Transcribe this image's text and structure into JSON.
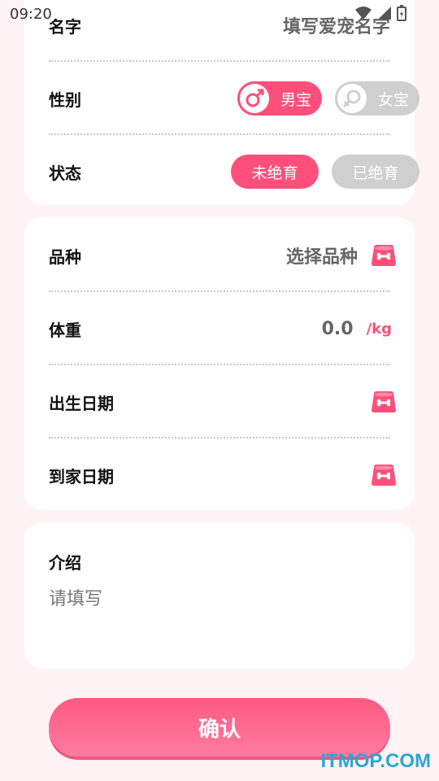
{
  "status_bar": {
    "time": "09:20"
  },
  "basic": {
    "name_label": "名字",
    "name_placeholder": "填写爱宠名字",
    "gender_label": "性别",
    "gender_options": [
      "男宝",
      "女宝"
    ],
    "gender_selected": "男宝",
    "status_label": "状态",
    "status_options": [
      "未绝育",
      "已绝育"
    ],
    "status_selected": "未绝育"
  },
  "details": {
    "breed_label": "品种",
    "breed_value": "选择品种",
    "weight_label": "体重",
    "weight_value": "0.0",
    "weight_unit": "/kg",
    "birth_label": "出生日期",
    "arrive_label": "到家日期"
  },
  "intro": {
    "label": "介绍",
    "placeholder": "请填写"
  },
  "confirm_label": "确认",
  "watermark": "ITMOP.COM",
  "colors": {
    "accent": "#ff4f7a",
    "inactive": "#cfcfcf",
    "background": "#fff3f5"
  }
}
